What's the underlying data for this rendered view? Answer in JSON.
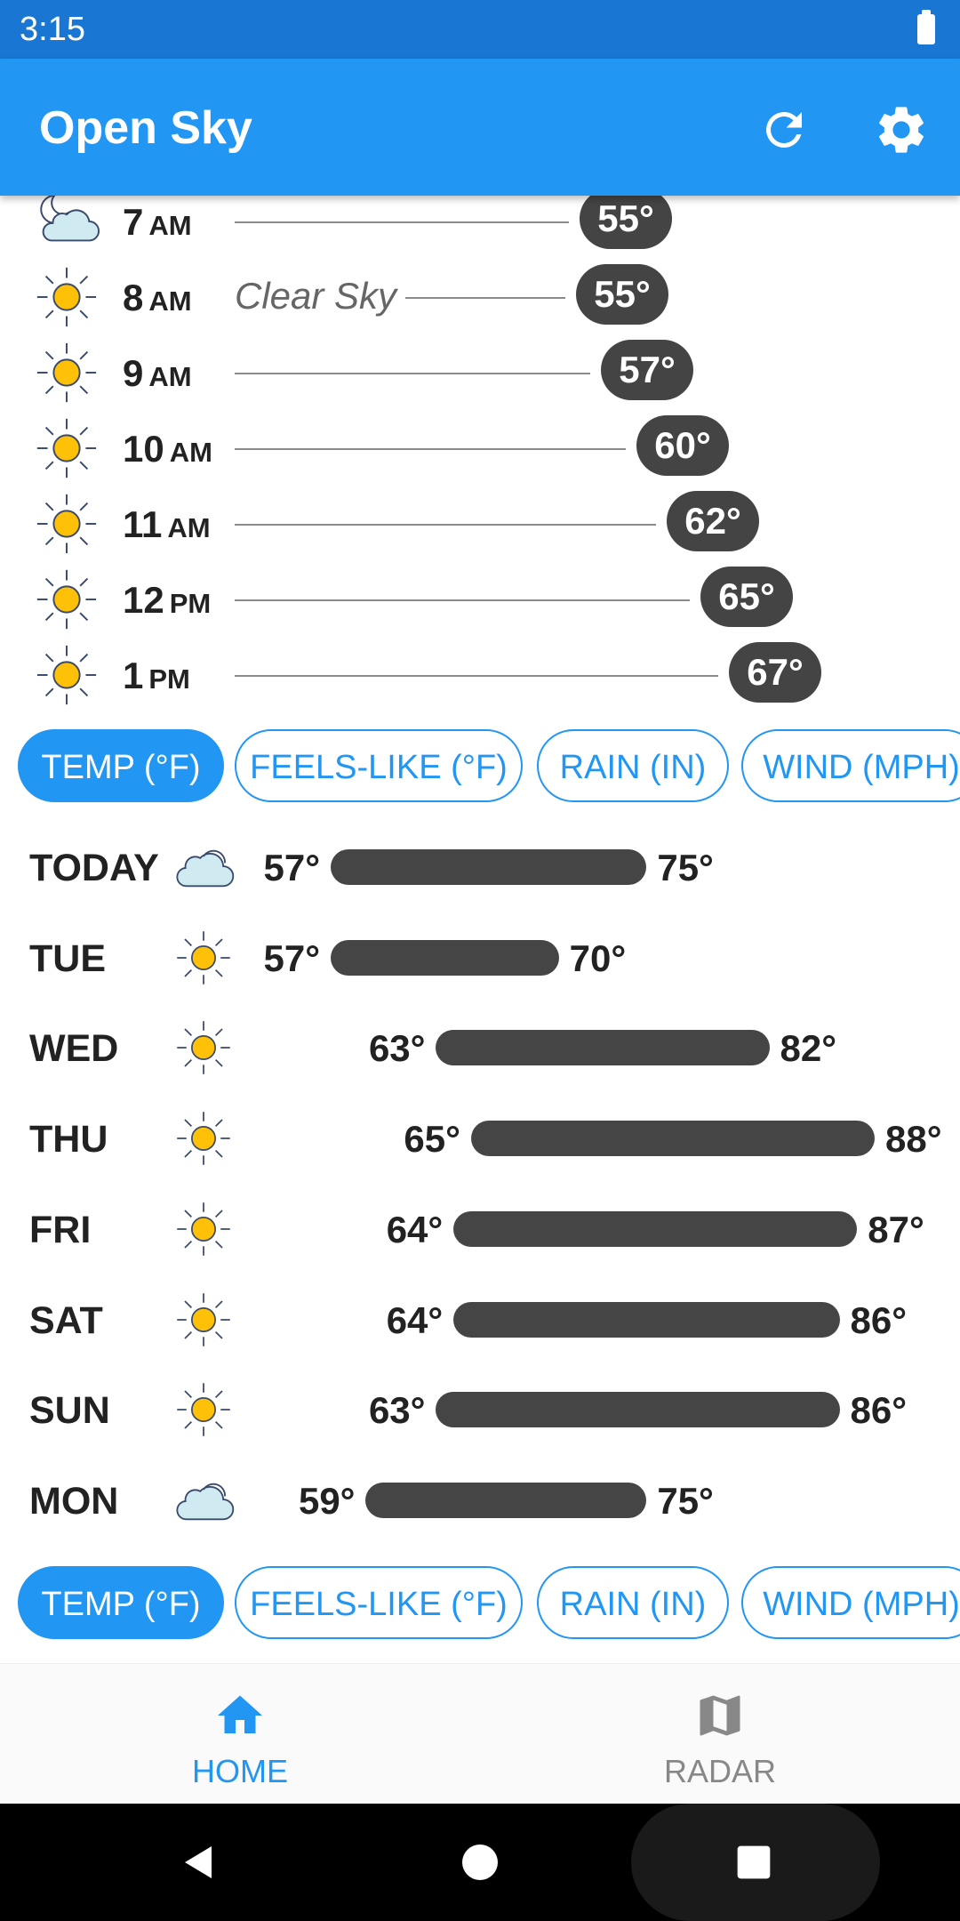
{
  "status_bar": {
    "time": "3:15"
  },
  "app_bar": {
    "title": "Open Sky",
    "refresh_icon": "refresh-icon",
    "settings_icon": "gear-icon"
  },
  "hourly": [
    {
      "time": "7",
      "ampm": "AM",
      "icon": "partly-cloudy-night-icon",
      "desc": "",
      "temp": "55°"
    },
    {
      "time": "8",
      "ampm": "AM",
      "icon": "sun-icon",
      "desc": "Clear Sky",
      "temp": "55°"
    },
    {
      "time": "9",
      "ampm": "AM",
      "icon": "sun-icon",
      "desc": "",
      "temp": "57°"
    },
    {
      "time": "10",
      "ampm": "AM",
      "icon": "sun-icon",
      "desc": "",
      "temp": "60°"
    },
    {
      "time": "11",
      "ampm": "AM",
      "icon": "sun-icon",
      "desc": "",
      "temp": "62°"
    },
    {
      "time": "12",
      "ampm": "PM",
      "icon": "sun-icon",
      "desc": "",
      "temp": "65°"
    },
    {
      "time": "1",
      "ampm": "PM",
      "icon": "sun-icon",
      "desc": "",
      "temp": "67°"
    }
  ],
  "hourly_chips": [
    {
      "label": "TEMP (°F)",
      "active": true
    },
    {
      "label": "FEELS-LIKE (°F)",
      "active": false
    },
    {
      "label": "RAIN (IN)",
      "active": false
    },
    {
      "label": "WIND (MPH)",
      "active": false
    }
  ],
  "daily": [
    {
      "day": "TODAY",
      "icon": "cloudy-icon",
      "low": "57°",
      "high": "75°"
    },
    {
      "day": "TUE",
      "icon": "sun-icon",
      "low": "57°",
      "high": "70°"
    },
    {
      "day": "WED",
      "icon": "sun-icon",
      "low": "63°",
      "high": "82°"
    },
    {
      "day": "THU",
      "icon": "sun-icon",
      "low": "65°",
      "high": "88°"
    },
    {
      "day": "FRI",
      "icon": "sun-icon",
      "low": "64°",
      "high": "87°"
    },
    {
      "day": "SAT",
      "icon": "sun-icon",
      "low": "64°",
      "high": "86°"
    },
    {
      "day": "SUN",
      "icon": "sun-icon",
      "low": "63°",
      "high": "86°"
    },
    {
      "day": "MON",
      "icon": "cloudy-icon",
      "low": "59°",
      "high": "75°"
    }
  ],
  "daily_chips": [
    {
      "label": "TEMP (°F)",
      "active": true
    },
    {
      "label": "FEELS-LIKE (°F)",
      "active": false
    },
    {
      "label": "RAIN (IN)",
      "active": false
    },
    {
      "label": "WIND (MPH)",
      "active": false
    }
  ],
  "bottom_nav": [
    {
      "label": "HOME",
      "icon": "home-icon",
      "active": true
    },
    {
      "label": "RADAR",
      "icon": "map-icon",
      "active": false
    }
  ],
  "colors": {
    "primary": "#2196f3",
    "status_bar": "#1976d2",
    "pill": "#444444",
    "sun": "#ffc107",
    "inactive": "#888888"
  }
}
